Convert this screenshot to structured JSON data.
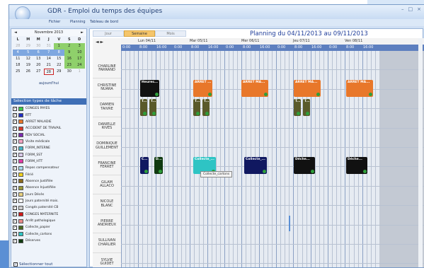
{
  "window": {
    "title": "GDR - Emploi du temps des équipes",
    "controls": [
      "–",
      "□",
      "×"
    ]
  },
  "menu": [
    "Fichier",
    "Planning",
    "Tableau de bord"
  ],
  "calendar": {
    "prev": "◄",
    "next": "►",
    "month_label": "Novembre 2013",
    "dow": [
      "L",
      "M",
      "M",
      "J",
      "V",
      "S",
      "D"
    ],
    "weeks": [
      [
        "28",
        "29",
        "30",
        "31",
        "1",
        "2",
        "3"
      ],
      [
        "4",
        "5",
        "6",
        "7",
        "8",
        "9",
        "10"
      ],
      [
        "11",
        "12",
        "13",
        "14",
        "15",
        "16",
        "17"
      ],
      [
        "18",
        "19",
        "20",
        "21",
        "22",
        "23",
        "24"
      ],
      [
        "25",
        "26",
        "27",
        "28",
        "29",
        "30",
        "1"
      ]
    ],
    "today_label": "aujourd'hui"
  },
  "task_types": {
    "header": "Sélection types de tâche",
    "items": [
      {
        "label": "CONGES PAYES",
        "color": "#3ec94a"
      },
      {
        "label": "RTT",
        "color": "#1f2fc4"
      },
      {
        "label": "ARRET MALADIE",
        "color": "#e8772a"
      },
      {
        "label": "ACCIDENT DE TRAVAIL",
        "color": "#d83b2a"
      },
      {
        "label": "RDV SOCIAL",
        "color": "#7a2bb0"
      },
      {
        "label": "Visite médicale",
        "color": "#f4a4c4"
      },
      {
        "label": "FORM_INTERNE",
        "color": "#48b6c8"
      },
      {
        "label": "FORM_SST",
        "color": "#d7c8e8"
      },
      {
        "label": "FORM_HTT",
        "color": "#e13ba7"
      },
      {
        "label": "Repos compensateur",
        "color": "#a7d9ea"
      },
      {
        "label": "Férié",
        "color": "#f0d020"
      },
      {
        "label": "Absence Justifiée",
        "color": "#8a6a1e"
      },
      {
        "label": "Absence Injustifiée",
        "color": "#9a9a3a"
      },
      {
        "label": "Jours Décès",
        "color": "#e8d080"
      },
      {
        "label": "Jours paternité mais.",
        "color": "#ffffff"
      },
      {
        "label": "Congés paternité CB",
        "color": "#cccccc"
      },
      {
        "label": "CONGES MATERNITE",
        "color": "#d01a1a"
      },
      {
        "label": "Arrêt pathologique",
        "color": "#e88a8a"
      },
      {
        "label": "Collecte_papier",
        "color": "#4a6a20"
      },
      {
        "label": "Collecte_cartons",
        "color": "#2ec4c4"
      },
      {
        "label": "Déserves",
        "color": "#103a10"
      }
    ],
    "select_all": "Sélectionner tout"
  },
  "view_tabs": [
    "Jour",
    "Semaine",
    "Mois"
  ],
  "active_tab": "Semaine",
  "planning_title": "Planning du 04/11/2013 au 09/11/2013",
  "nav": "◄   ►",
  "days": [
    "Lun 04/11",
    "Mar 05/11",
    "Mer 06/11",
    "Jeu 07/11",
    "Ven 08/11"
  ],
  "hours": [
    "0:00",
    "8:00",
    "16:00"
  ],
  "employees": [
    "CHARLINE\nFARRAND",
    "CHRISTINE\nNUARA",
    "DAMIEN\nTAIVRE",
    "DANIELLE\nRIVES",
    "DOMINIQUE\nGUILLEMENT",
    "FRANCINE\nFERRET",
    "GILAM\nALLACO",
    "NICOLE\nBLANC",
    "PIERRE\nANDRIEUX",
    "SULLIVAN\nCHARLIER",
    "SYLVIE\nGUIDET"
  ],
  "events": [
    {
      "label": "Heures...",
      "color": "#111111"
    },
    {
      "label": "ARRET ...",
      "color": "#e8772a"
    },
    {
      "label": "ARRET MA...",
      "color": "#e8772a"
    },
    {
      "label": "ARRET MA...",
      "color": "#e8772a"
    },
    {
      "label": "ARRET MA...",
      "color": "#e8772a"
    },
    {
      "label": "T...",
      "color": "#5a5a2a"
    },
    {
      "label": "T...",
      "color": "#5a5a2a"
    },
    {
      "label": "T...",
      "color": "#5a5a2a"
    },
    {
      "label": "T...",
      "color": "#5a5a2a"
    },
    {
      "label": "T...",
      "color": "#5a5a2a"
    },
    {
      "label": "T...",
      "color": "#5a5a2a"
    },
    {
      "label": "C...",
      "color": "#101860"
    },
    {
      "label": "D...",
      "color": "#103a10"
    },
    {
      "label": "Collecte_...",
      "color": "#2ec4c4"
    },
    {
      "label": "Collecte_...",
      "color": "#101860"
    },
    {
      "label": "Déche...",
      "color": "#111111"
    },
    {
      "label": "Déche...",
      "color": "#111111"
    }
  ],
  "tooltip": "Collecte_cartons"
}
